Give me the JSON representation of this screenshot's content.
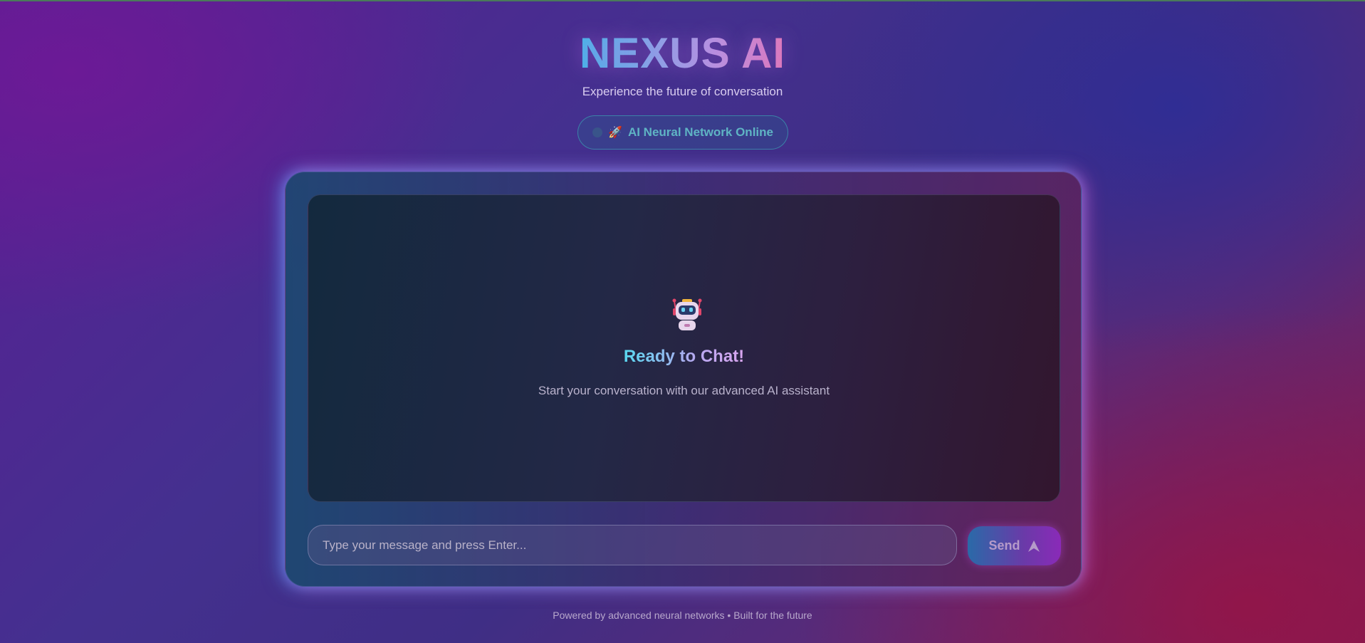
{
  "app": {
    "title": "NEXUS AI",
    "subtitle": "Experience the future of conversation"
  },
  "status": {
    "icon": "rocket-icon",
    "label": "AI Neural Network Online"
  },
  "chat": {
    "empty_state": {
      "icon": "robot-icon",
      "title": "Ready to Chat!",
      "description": "Start your conversation with our advanced AI assistant"
    },
    "input": {
      "value": "",
      "placeholder": "Type your message and press Enter..."
    },
    "send_label": "Send",
    "send_icon": "send-arrow-icon"
  },
  "footer": {
    "text": "Powered by advanced neural networks • Built for the future"
  },
  "colors": {
    "accent_cyan": "#3fb8e8",
    "accent_pink": "#e07ab8",
    "status_text": "#5fb4c4"
  }
}
